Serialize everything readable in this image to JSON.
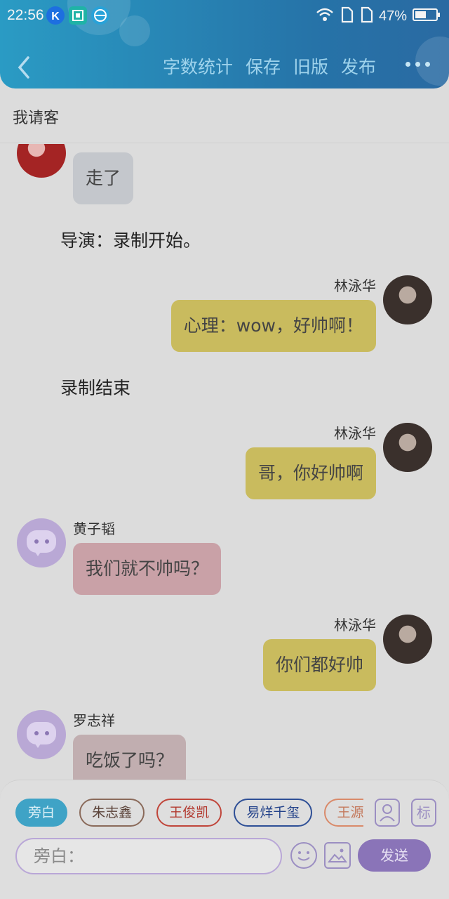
{
  "status_bar": {
    "time": "22:56",
    "battery": "47%"
  },
  "header": {
    "actions": [
      "字数统计",
      "保存",
      "旧版",
      "发布"
    ]
  },
  "page_title": "我请客",
  "messages": {
    "m1": {
      "text": "走了"
    },
    "n1": {
      "text": "导演：录制开始。"
    },
    "m2": {
      "name": "林泳华",
      "text": "心理：wow，好帅啊！"
    },
    "n2": {
      "text": "录制结束"
    },
    "m3": {
      "name": "林泳华",
      "text": "哥，你好帅啊"
    },
    "m4": {
      "name": "黄子韬",
      "text": "我们就不帅吗？"
    },
    "m5": {
      "name": "林泳华",
      "text": "你们都好帅"
    },
    "m6": {
      "name": "罗志祥",
      "text": "吃饭了吗？"
    }
  },
  "composer": {
    "chips": [
      "旁白",
      "朱志鑫",
      "王俊凯",
      "易烊千玺",
      "王源"
    ],
    "tag_label": "标",
    "placeholder": "旁白：",
    "send_label": "发送"
  },
  "colors": {
    "header": "#2673a8",
    "self_bubble": "#c9bb5e",
    "accent": "#8a74b8"
  }
}
